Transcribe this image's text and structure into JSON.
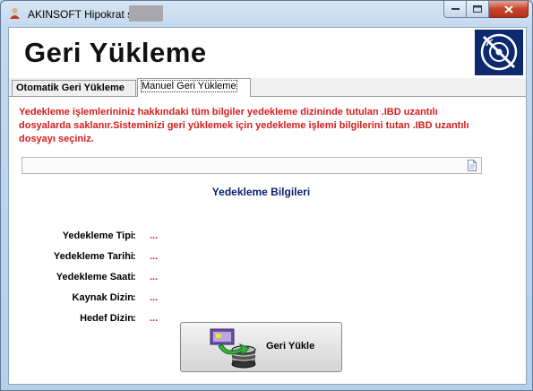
{
  "window": {
    "title": "AKINSOFT Hipokrat s"
  },
  "header": {
    "title": "Geri Yükleme"
  },
  "tabs": [
    {
      "label": "Otomatik Geri Yükleme",
      "active": false
    },
    {
      "label": "Manuel Geri Yükleme",
      "active": true
    }
  ],
  "main": {
    "info_text": "Yedekleme işlemlerininiz hakkındaki tüm bilgiler yedekleme dizininde tutulan .IBD uzantılı dosyalarda saklanır.Sisteminizi geri yüklemek için yedekleme işlemi bilgilerini tutan .IBD uzantılı dosyayı seçiniz.",
    "file_path_value": "",
    "section_title": "Yedekleme Bilgileri",
    "fields": [
      {
        "label": "Yedekleme Tipi",
        "colon": ":",
        "value": "..."
      },
      {
        "label": "Yedekleme Tarihi",
        "colon": ":",
        "value": "..."
      },
      {
        "label": "Yedekleme Saati",
        "colon": ":",
        "value": "..."
      },
      {
        "label": "Kaynak Dizin",
        "colon": ":",
        "value": "..."
      },
      {
        "label": "Hedef Dizin",
        "colon": ":",
        "value": "..."
      }
    ],
    "restore_button_label": "Geri Yükle"
  },
  "colors": {
    "warning_text": "#d61c1c",
    "section_title": "#0b1f6e",
    "logo_bg": "#0e2a6e"
  },
  "icons": [
    "app-icon",
    "minimize-icon",
    "maximize-icon",
    "close-icon",
    "cd-logo-icon",
    "file-browse-icon",
    "restore-database-icon"
  ]
}
